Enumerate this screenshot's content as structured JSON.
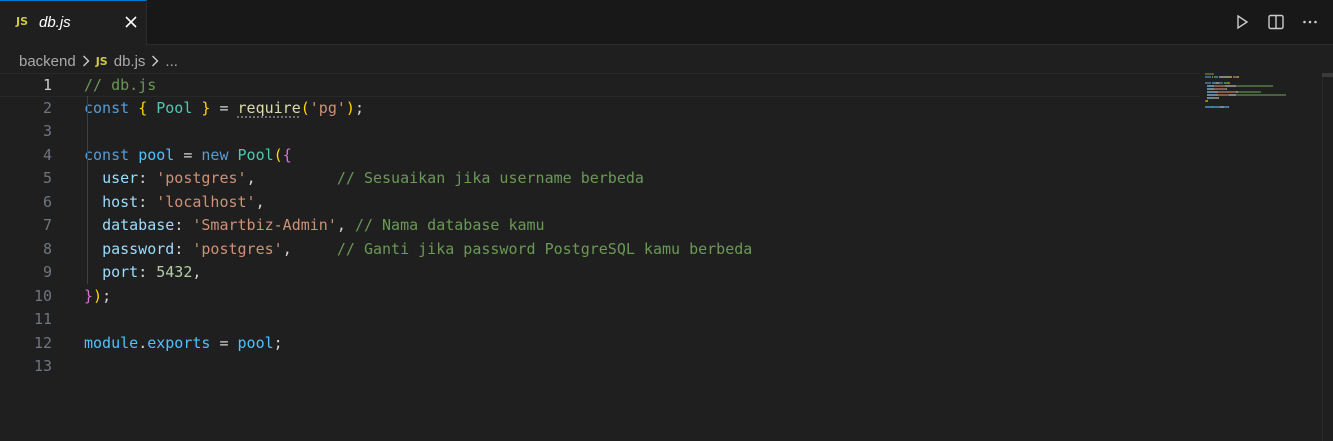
{
  "tab": {
    "badge": "JS",
    "title": "db.js"
  },
  "breadcrumb": {
    "folder": "backend",
    "badge": "JS",
    "file": "db.js",
    "more": "..."
  },
  "editor": {
    "lines": [
      {
        "num": "1",
        "tokens": [
          {
            "t": "// db.js",
            "c": "c-cm"
          }
        ]
      },
      {
        "num": "2",
        "tokens": [
          {
            "t": "const",
            "c": "c-kw"
          },
          {
            "t": " ",
            "c": ""
          },
          {
            "t": "{",
            "c": "c-b1"
          },
          {
            "t": " ",
            "c": ""
          },
          {
            "t": "Pool",
            "c": "c-ty"
          },
          {
            "t": " ",
            "c": ""
          },
          {
            "t": "}",
            "c": "c-b1"
          },
          {
            "t": " = ",
            "c": "c-op"
          },
          {
            "t": "require",
            "c": "c-fn squiggle"
          },
          {
            "t": "(",
            "c": "c-b1"
          },
          {
            "t": "'pg'",
            "c": "c-st"
          },
          {
            "t": ")",
            "c": "c-b1"
          },
          {
            "t": ";",
            "c": "c-op"
          }
        ]
      },
      {
        "num": "3",
        "tokens": []
      },
      {
        "num": "4",
        "tokens": [
          {
            "t": "const",
            "c": "c-kw"
          },
          {
            "t": " ",
            "c": ""
          },
          {
            "t": "pool",
            "c": "c-vr"
          },
          {
            "t": " = ",
            "c": "c-op"
          },
          {
            "t": "new",
            "c": "c-kw"
          },
          {
            "t": " ",
            "c": ""
          },
          {
            "t": "Pool",
            "c": "c-ty"
          },
          {
            "t": "(",
            "c": "c-b1"
          },
          {
            "t": "{",
            "c": "c-b2"
          }
        ]
      },
      {
        "num": "5",
        "tokens": [
          {
            "t": "  ",
            "c": ""
          },
          {
            "t": "user",
            "c": "c-pr"
          },
          {
            "t": ": ",
            "c": "c-op"
          },
          {
            "t": "'postgres'",
            "c": "c-st"
          },
          {
            "t": ",         ",
            "c": "c-op"
          },
          {
            "t": "// Sesuaikan jika username berbeda",
            "c": "c-cm"
          }
        ]
      },
      {
        "num": "6",
        "tokens": [
          {
            "t": "  ",
            "c": ""
          },
          {
            "t": "host",
            "c": "c-pr"
          },
          {
            "t": ": ",
            "c": "c-op"
          },
          {
            "t": "'localhost'",
            "c": "c-st"
          },
          {
            "t": ",",
            "c": "c-op"
          }
        ]
      },
      {
        "num": "7",
        "tokens": [
          {
            "t": "  ",
            "c": ""
          },
          {
            "t": "database",
            "c": "c-pr"
          },
          {
            "t": ": ",
            "c": "c-op"
          },
          {
            "t": "'Smartbiz-Admin'",
            "c": "c-st"
          },
          {
            "t": ", ",
            "c": "c-op"
          },
          {
            "t": "// Nama database kamu",
            "c": "c-cm"
          }
        ]
      },
      {
        "num": "8",
        "tokens": [
          {
            "t": "  ",
            "c": ""
          },
          {
            "t": "password",
            "c": "c-pr"
          },
          {
            "t": ": ",
            "c": "c-op"
          },
          {
            "t": "'postgres'",
            "c": "c-st"
          },
          {
            "t": ",     ",
            "c": "c-op"
          },
          {
            "t": "// Ganti jika password PostgreSQL kamu berbeda",
            "c": "c-cm"
          }
        ]
      },
      {
        "num": "9",
        "tokens": [
          {
            "t": "  ",
            "c": ""
          },
          {
            "t": "port",
            "c": "c-pr"
          },
          {
            "t": ": ",
            "c": "c-op"
          },
          {
            "t": "5432",
            "c": "c-nu"
          },
          {
            "t": ",",
            "c": "c-op"
          }
        ]
      },
      {
        "num": "10",
        "tokens": [
          {
            "t": "}",
            "c": "c-b2"
          },
          {
            "t": ")",
            "c": "c-b1"
          },
          {
            "t": ";",
            "c": "c-op"
          }
        ]
      },
      {
        "num": "11",
        "tokens": []
      },
      {
        "num": "12",
        "tokens": [
          {
            "t": "module",
            "c": "c-vr"
          },
          {
            "t": ".",
            "c": "c-op"
          },
          {
            "t": "exports",
            "c": "c-vr"
          },
          {
            "t": " = ",
            "c": "c-op"
          },
          {
            "t": "pool",
            "c": "c-vr"
          },
          {
            "t": ";",
            "c": "c-op"
          }
        ]
      },
      {
        "num": "13",
        "tokens": []
      }
    ],
    "active_line": "1"
  },
  "colors": {
    "comment": "#6a9955",
    "keyword": "#569cd6",
    "type": "#4ec9b0",
    "function": "#dcdcaa",
    "string": "#ce9178",
    "number": "#b5cea8",
    "property": "#9cdcfe",
    "variable": "#4fc1ff",
    "accent": "#0078d4"
  },
  "icons": {
    "close": "close-icon",
    "run": "play-icon",
    "split": "split-editor-icon",
    "more": "more-actions-icon",
    "chevron": "chevron-right-icon"
  }
}
